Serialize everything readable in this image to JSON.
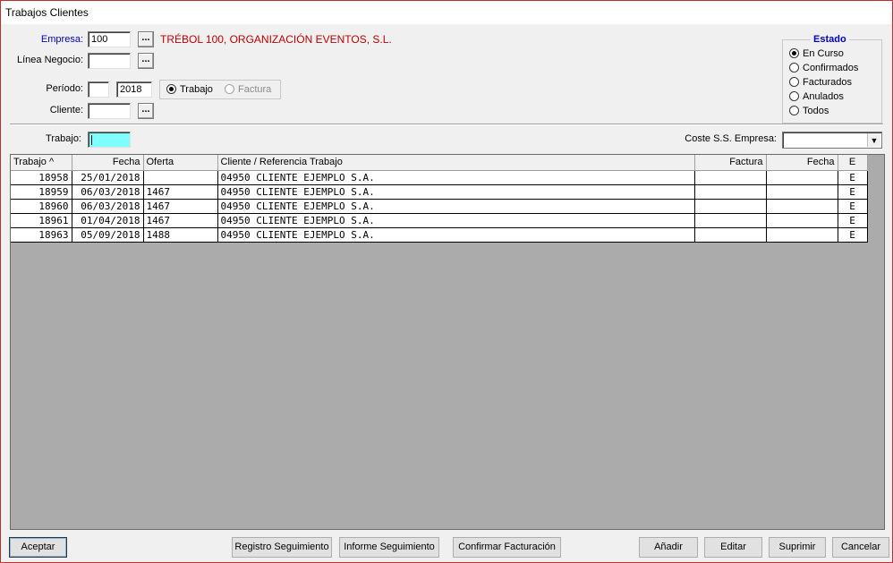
{
  "window": {
    "title": "Trabajos Clientes"
  },
  "filters": {
    "empresa_label": "Empresa:",
    "empresa_value": "100",
    "empresa_name": "TRÉBOL 100, ORGANIZACIÓN EVENTOS, S.L.",
    "linea_negocio_label": "Línea Negocio:",
    "linea_negocio_value": "",
    "periodo_label": "Período:",
    "periodo_month": "",
    "periodo_year": "2018",
    "periodo_mode": {
      "trabajo_label": "Trabajo",
      "factura_label": "Factura",
      "selected": "Trabajo"
    },
    "cliente_label": "Cliente:",
    "cliente_value": "",
    "trabajo_label": "Trabajo:",
    "trabajo_value": "",
    "coste_label": "Coste S.S. Empresa:",
    "coste_value": ""
  },
  "estado": {
    "title": "Estado",
    "selected": "En Curso",
    "options": [
      "En Curso",
      "Confirmados",
      "Facturados",
      "Anulados",
      "Todos"
    ]
  },
  "table": {
    "headers": {
      "trabajo": "Trabajo ^",
      "fecha": "Fecha",
      "oferta": "Oferta",
      "cliente": "Cliente / Referencia Trabajo",
      "factura": "Factura",
      "fecha_factura": "Fecha",
      "e": "E"
    },
    "rows": [
      {
        "trabajo": "18958",
        "fecha": "25/01/2018",
        "oferta": "",
        "cliente": "04950 CLIENTE EJEMPLO S.A.",
        "factura": "",
        "fecha_factura": "",
        "e": "E"
      },
      {
        "trabajo": "18959",
        "fecha": "06/03/2018",
        "oferta": "1467",
        "cliente": "04950 CLIENTE EJEMPLO S.A.",
        "factura": "",
        "fecha_factura": "",
        "e": "E"
      },
      {
        "trabajo": "18960",
        "fecha": "06/03/2018",
        "oferta": "1467",
        "cliente": "04950 CLIENTE EJEMPLO S.A.",
        "factura": "",
        "fecha_factura": "",
        "e": "E"
      },
      {
        "trabajo": "18961",
        "fecha": "01/04/2018",
        "oferta": "1467",
        "cliente": "04950 CLIENTE EJEMPLO S.A.",
        "factura": "",
        "fecha_factura": "",
        "e": "E"
      },
      {
        "trabajo": "18963",
        "fecha": "05/09/2018",
        "oferta": "1488",
        "cliente": "04950 CLIENTE EJEMPLO S.A.",
        "factura": "",
        "fecha_factura": "",
        "e": "E"
      }
    ]
  },
  "buttons": {
    "aceptar": "Aceptar",
    "registro": "Registro Seguimiento",
    "informe": "Informe Seguimiento",
    "confirmar": "Confirmar Facturación",
    "anadir": "Añadir",
    "editar": "Editar",
    "suprimir": "Suprimir",
    "cancelar": "Cancelar"
  },
  "colors": {
    "empresa_label": "#0000c0",
    "empresa_name": "#c00000",
    "estado_title": "#0000c0",
    "trabajo_input": "#80ffff"
  }
}
